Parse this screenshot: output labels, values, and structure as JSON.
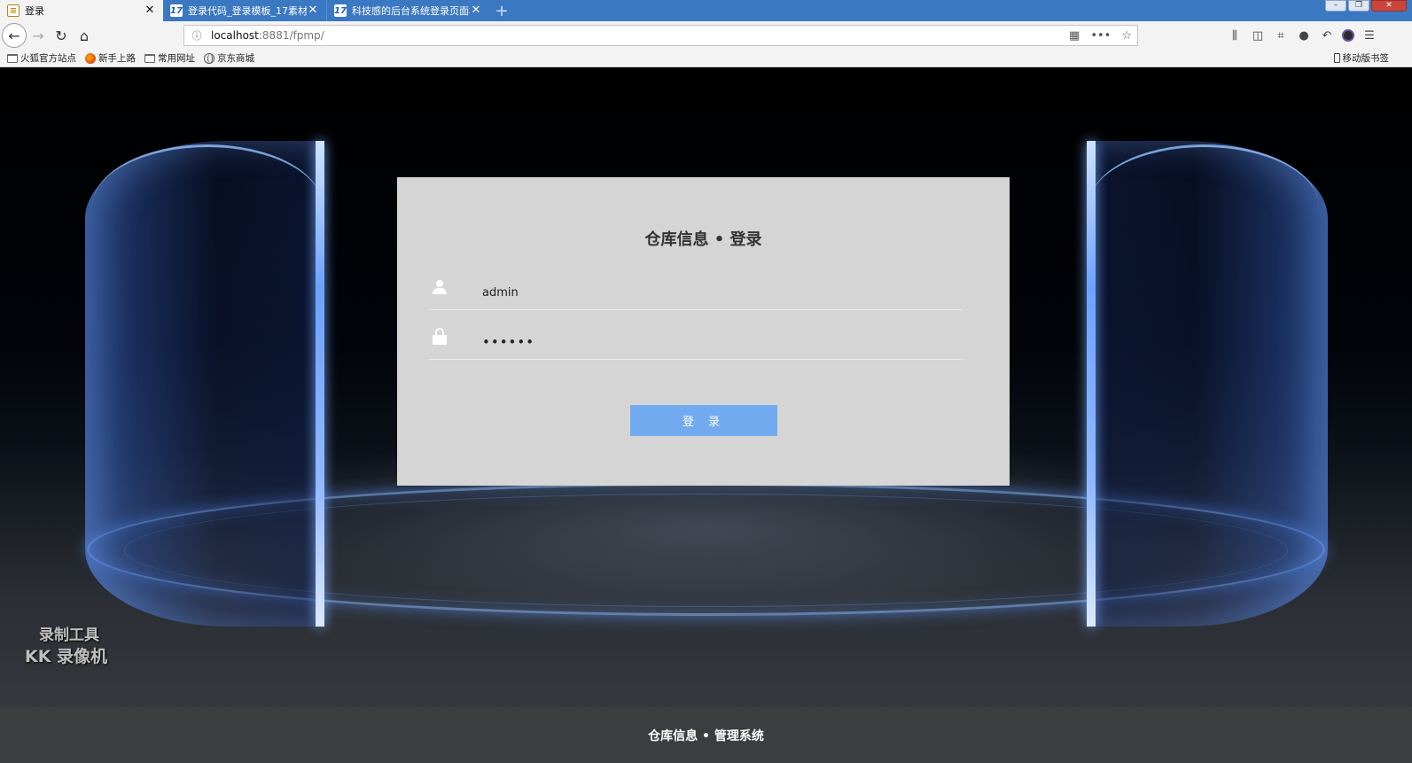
{
  "browser": {
    "tabs": [
      {
        "title": "登录",
        "active": true
      },
      {
        "title": "登录代码_登录模板_17素材网",
        "active": false
      },
      {
        "title": "科技感的后台系统登录页面模板",
        "active": false
      }
    ],
    "url": {
      "host": "localhost",
      "port": ":8881",
      "path": "/fpmp/"
    },
    "bookmarks": [
      {
        "label": "火狐官方站点",
        "icon": "folder-icon"
      },
      {
        "label": "新手上路",
        "icon": "firefox-icon"
      },
      {
        "label": "常用网址",
        "icon": "folder-icon"
      },
      {
        "label": "京东商城",
        "icon": "globe-icon"
      }
    ],
    "mobile_bookmarks": "移动版书签"
  },
  "login": {
    "title": "仓库信息 • 登录",
    "username_value": "admin",
    "password_value": "••••••",
    "button_label": "登 录"
  },
  "footer": {
    "text": "仓库信息 • 管理系统"
  },
  "watermark": {
    "line1": "录制工具",
    "line2": "KK 录像机"
  },
  "colors": {
    "tab_strip": "#3b78c2",
    "card_bg": "#d5d5d5",
    "button_bg": "#72aaf0",
    "footer_bg": "#3c3d3f"
  }
}
